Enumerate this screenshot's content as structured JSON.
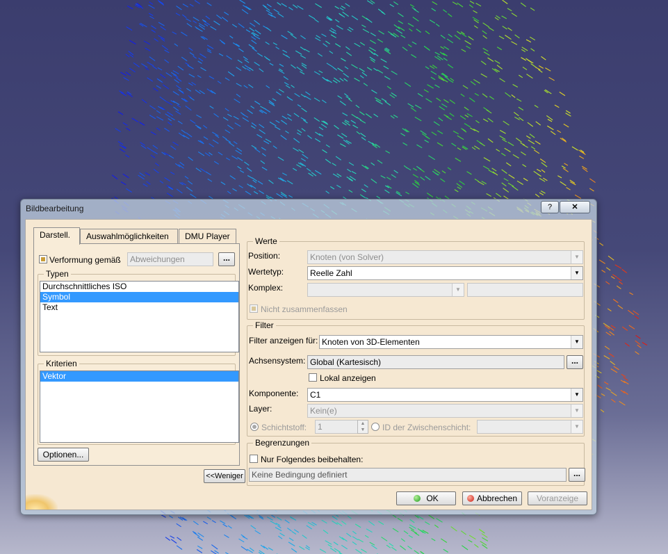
{
  "dialog": {
    "title": "Bildbearbeitung",
    "help_label": "?",
    "close_label": "✕"
  },
  "tabs": [
    {
      "label": "Darstell."
    },
    {
      "label": "Auswahlmöglichkeiten"
    },
    {
      "label": "DMU Player"
    }
  ],
  "display_tab": {
    "deformation_label": "Verformung gemäß",
    "deformation_checked": true,
    "deformation_value": "Abweichungen",
    "dots_label": "...",
    "types_title": "Typen",
    "types": [
      "Durchschnittliches ISO",
      "Symbol",
      "Text"
    ],
    "types_selected": "Symbol",
    "criteria_title": "Kriterien",
    "criteria": [
      "Vektor"
    ],
    "criteria_selected": "Vektor",
    "options_button": "Optionen..."
  },
  "less_button": "<<Weniger",
  "werte": {
    "title": "Werte",
    "position_label": "Position:",
    "position_value": "Knoten (von Solver)",
    "wertetyp_label": "Wertetyp:",
    "wertetyp_value": "Reelle Zahl",
    "komplex_label": "Komplex:",
    "komplex_value": "",
    "komplex_value2": "",
    "nicht_zusammenfassen": "Nicht zusammenfassen"
  },
  "filter": {
    "title": "Filter",
    "anzeigen_label": "Filter anzeigen für:",
    "anzeigen_value": "Knoten von 3D-Elementen",
    "achsensystem_label": "Achsensystem:",
    "achsensystem_value": "Global (Kartesisch)",
    "lokal_label": "Lokal anzeigen",
    "komponente_label": "Komponente:",
    "komponente_value": "C1",
    "layer_label": "Layer:",
    "layer_value": "Kein(e)",
    "schichtstoff_label": "Schichtstoff:",
    "schichtstoff_value": "1",
    "zwischenschicht_label": "ID der Zwischenschicht:",
    "zwischenschicht_value": ""
  },
  "begrenzungen": {
    "title": "Begrenzungen",
    "nur_label": "Nur Folgendes beibehalten:",
    "condition_value": "Keine Bedingung definiert"
  },
  "buttons": {
    "ok": "OK",
    "cancel": "Abbrechen",
    "preview": "Voranzeige"
  },
  "colors": {
    "dialog_bg": "#f6e8d2",
    "selection": "#3399ff",
    "viewport_bg": "#3b3d6e"
  }
}
